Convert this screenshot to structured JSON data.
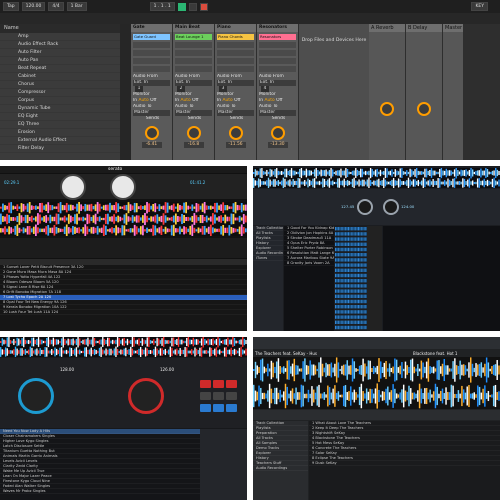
{
  "ableton": {
    "topbar": [
      "Tap",
      "4/4",
      "1 Bar",
      "1 . 1 . 1",
      "KEY"
    ],
    "tempo": "120.00",
    "browser_header": "Name",
    "browser_items": [
      "Amp",
      "Audio Effect Rack",
      "Auto Filter",
      "Auto Pan",
      "Beat Repeat",
      "Cabinet",
      "Chorus",
      "Compressor",
      "Corpus",
      "Dynamic Tube",
      "EQ Eight",
      "EQ Three",
      "Erosion",
      "External Audio Effect",
      "Filter Delay"
    ],
    "tracks": [
      {
        "name": "Gate",
        "clip": "Gate Guard",
        "clip_color": "#7ec4ff",
        "vol": "-6.41",
        "num": "1"
      },
      {
        "name": "Main Beat",
        "clip": "Beat Lounge 1",
        "clip_color": "#6ccf5c",
        "vol": "-16.8",
        "num": "2"
      },
      {
        "name": "Piano",
        "clip": "Piano Chords",
        "clip_color": "#f5c342",
        "vol": "-11.56",
        "num": "3"
      },
      {
        "name": "Resonators",
        "clip": "Resonators",
        "clip_color": "#ff6f91",
        "vol": "-13.30",
        "num": "4"
      }
    ],
    "track_labels": {
      "audio_from": "Audio From",
      "ext_in": "Ext. In",
      "monitor": "Monitor",
      "in": "In",
      "auto": "Auto",
      "off": "Off",
      "audio_to": "Audio To",
      "master": "Master",
      "sends": "Sends"
    },
    "drop_text": "Drop Files and Devices Here",
    "returns": [
      {
        "name": "A Reverb"
      },
      {
        "name": "B Delay"
      }
    ],
    "master": "Master"
  },
  "serato": {
    "title": "serato",
    "deck1_time": "02:29.1",
    "deck2_time": "01:41.2",
    "rows": [
      [
        "1",
        "Sunset Lover",
        "Petit Biscuit",
        "Presence",
        "3A",
        "120"
      ],
      [
        "2",
        "Gone",
        "Mura Masa",
        "Mura Masa",
        "8A",
        "124"
      ],
      [
        "3",
        "Phases",
        "Yotto",
        "Hyperfall",
        "4A",
        "122"
      ],
      [
        "4",
        "Bloom",
        "Odesza",
        "Bloom",
        "5A",
        "120"
      ],
      [
        "5",
        "Signal",
        "Lane 8",
        "Rise",
        "6A",
        "124"
      ],
      [
        "6",
        "Drift",
        "Bonobo",
        "Migration",
        "7A",
        "118"
      ],
      [
        "7",
        "Lost",
        "Tycho",
        "Epoch",
        "2A",
        "120"
      ],
      [
        "8",
        "Opal",
        "Four Tet",
        "New Energy",
        "9A",
        "126"
      ],
      [
        "9",
        "Kerala",
        "Bonobo",
        "Migration",
        "10A",
        "122"
      ],
      [
        "10",
        "Lush",
        "Four Tet",
        "Lush",
        "11A",
        "124"
      ]
    ]
  },
  "traktor": {
    "title": "TRAKTOR",
    "deck_a": "127.45",
    "deck_b": "124.00",
    "tree": [
      "Track Collection",
      "All Tracks",
      "Playlists",
      "History",
      "Explorer",
      "Audio Recordings",
      "iTunes"
    ],
    "rows": [
      [
        "1",
        "Good For You",
        "Kidnap Kid",
        "7A"
      ],
      [
        "2",
        "Oblivion",
        "Jon Hopkins",
        "4A"
      ],
      [
        "3",
        "Strobe",
        "Deadmau5",
        "11A"
      ],
      [
        "4",
        "Opus",
        "Eric Prydz",
        "8A"
      ],
      [
        "5",
        "Shelter",
        "Porter Robinson",
        "3A"
      ],
      [
        "6",
        "Resolution",
        "Matt Lange",
        "6A"
      ],
      [
        "7",
        "Aurora",
        "Maribou State",
        "9A"
      ],
      [
        "8",
        "Gravity",
        "Joris Voorn",
        "2A"
      ]
    ]
  },
  "vdj": {
    "title": "VirtualDJ",
    "deck1_time": "128.00",
    "deck2_time": "126.00",
    "rows": [
      [
        "Need You Now",
        "Lady A",
        "Hits"
      ],
      [
        "Closer",
        "Chainsmokers",
        "Singles"
      ],
      [
        "Higher Love",
        "Kygo",
        "Singles"
      ],
      [
        "Latch",
        "Disclosure",
        "Settle"
      ],
      [
        "Titanium",
        "Guetta",
        "Nothing But"
      ],
      [
        "Animals",
        "Martin Garrix",
        "Animals"
      ],
      [
        "Levels",
        "Avicii",
        "Levels"
      ],
      [
        "Clarity",
        "Zedd",
        "Clarity"
      ],
      [
        "Wake Me Up",
        "Avicii",
        "True"
      ],
      [
        "Lean On",
        "Major Lazer",
        "Peace"
      ],
      [
        "Firestone",
        "Kygo",
        "Cloud Nine"
      ],
      [
        "Faded",
        "Alan Walker",
        "Singles"
      ],
      [
        "Waves",
        "Mr Probz",
        "Singles"
      ]
    ]
  },
  "traktor2": {
    "deck_a_title": "The Teachers feat. SeKay - Hus",
    "deck_b_title": "Blackstone feat. Hot 1",
    "tree": [
      "Track Collection",
      "Playlists",
      "Preparation",
      "All Tracks",
      "All Samples",
      "Demo Tracks",
      "Explorer",
      "History",
      "Teachers Stuff",
      "Audio Recordings"
    ],
    "rows": [
      [
        "1",
        "What About Love",
        "The Teachers"
      ],
      [
        "2",
        "Keep It Deep",
        "The Teachers"
      ],
      [
        "3",
        "Nightshift",
        "SeKay"
      ],
      [
        "4",
        "Blackstone",
        "The Teachers"
      ],
      [
        "5",
        "Hot Mess",
        "SeKay"
      ],
      [
        "6",
        "Concrete",
        "The Teachers"
      ],
      [
        "7",
        "Solar",
        "SeKay"
      ],
      [
        "8",
        "Eclipse",
        "The Teachers"
      ],
      [
        "9",
        "Dusk",
        "SeKay"
      ]
    ]
  }
}
